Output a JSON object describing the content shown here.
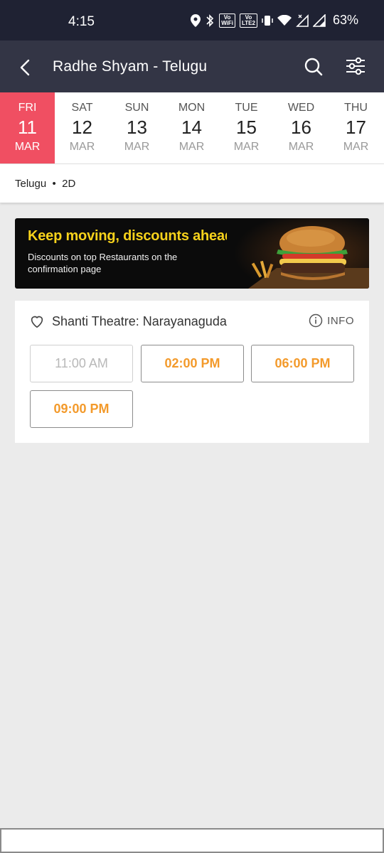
{
  "status_bar": {
    "time": "4:15",
    "battery": "63%",
    "wifi_badge_1": "Vo",
    "wifi_badge_2": "WiFi",
    "lte_badge_1": "Vo",
    "lte_badge_2": "LTE2"
  },
  "header": {
    "title": "Radhe Shyam - Telugu"
  },
  "dates": [
    {
      "day": "FRI",
      "num": "11",
      "month": "MAR",
      "selected": true
    },
    {
      "day": "SAT",
      "num": "12",
      "month": "MAR"
    },
    {
      "day": "SUN",
      "num": "13",
      "month": "MAR"
    },
    {
      "day": "MON",
      "num": "14",
      "month": "MAR"
    },
    {
      "day": "TUE",
      "num": "15",
      "month": "MAR"
    },
    {
      "day": "WED",
      "num": "16",
      "month": "MAR"
    },
    {
      "day": "THU",
      "num": "17",
      "month": "MAR"
    }
  ],
  "format": {
    "label": "Telugu  •  2D"
  },
  "banner": {
    "headline": "Keep moving, discounts ahead!",
    "subtext": "Discounts on top Restaurants on the confirmation page"
  },
  "theatre": {
    "name": "Shanti Theatre: Narayanaguda",
    "info_label": "INFO",
    "showtimes": [
      {
        "time": "11:00 AM",
        "available": false
      },
      {
        "time": "02:00 PM",
        "available": true
      },
      {
        "time": "06:00 PM",
        "available": true
      },
      {
        "time": "09:00 PM",
        "available": true
      }
    ]
  },
  "colors": {
    "status_bar_bg": "#1f2233",
    "app_bar_bg": "#333545",
    "selected_date_bg": "#f04f62",
    "showtime_available": "#f39a2b",
    "showtime_disabled": "#b8b8b8",
    "banner_headline": "#f7d21b"
  },
  "icons": [
    "back-arrow-icon",
    "search-icon",
    "filter-icon",
    "heart-icon",
    "info-icon",
    "location-icon",
    "bluetooth-icon",
    "vibrate-icon",
    "wifi-icon",
    "signal-icon"
  ]
}
